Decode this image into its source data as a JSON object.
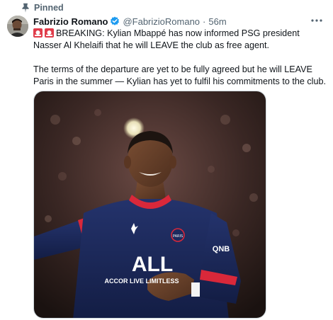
{
  "pinned": {
    "label": "Pinned"
  },
  "author": {
    "display_name": "Fabrizio Romano",
    "handle": "@FabrizioRomano",
    "separator": "·",
    "time": "56m"
  },
  "tweet": {
    "paragraph1": "BREAKING: Kylian Mbappé has now informed PSG president Nasser Al Khelaifi that he will LEAVE the club as free agent.",
    "paragraph2": "The terms of the departure are yet to be fully agreed but he will LEAVE Paris in the summer — Kylian has yet to fulfil his commitments to the club."
  },
  "media": {
    "jersey_sponsor": "ALL",
    "jersey_sponsor_sub": "ACCOR LIVE LIMITLESS",
    "sleeve_logo": "QNB",
    "crest_text": "PARIS"
  },
  "icons": {
    "pin": "pin-icon",
    "verified": "verified-badge-icon",
    "siren": "siren-emoji-icon",
    "more": "more-options-icon"
  },
  "colors": {
    "verified_blue": "#1d9bf0",
    "secondary_text": "#536471",
    "jersey_navy": "#1c2a5e",
    "jersey_red": "#d9283a"
  }
}
